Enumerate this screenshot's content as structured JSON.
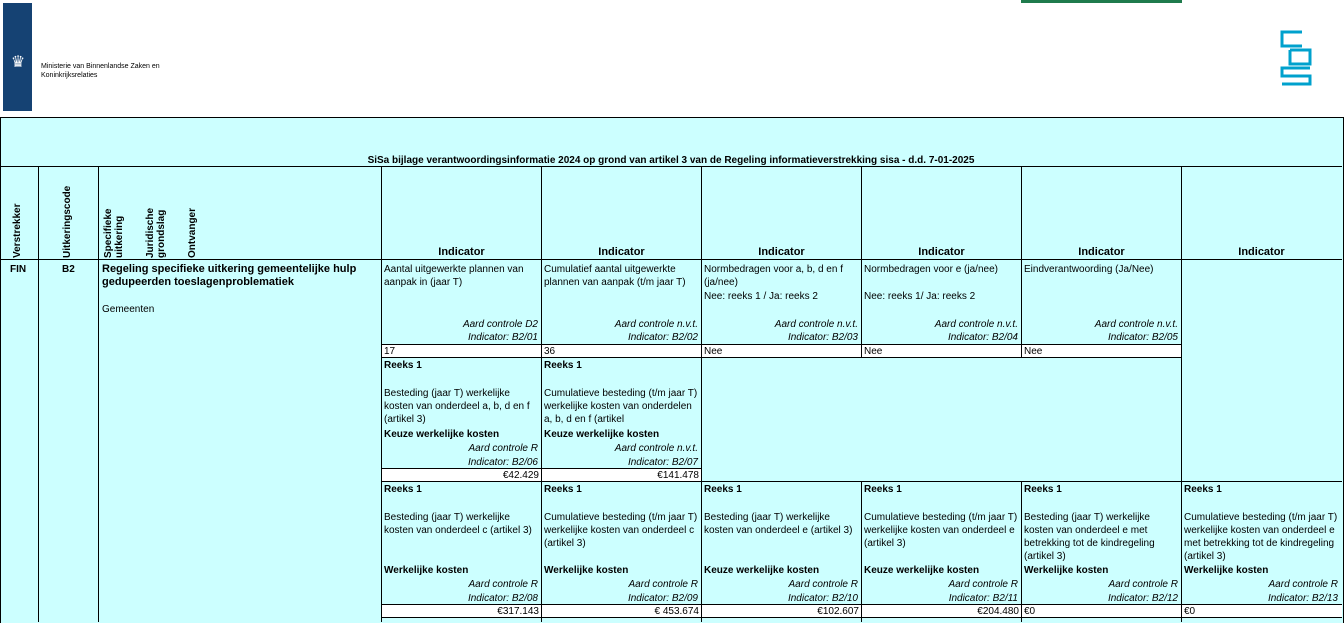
{
  "header": {
    "ministry_line1": "Ministerie van Binnenlandse Zaken en",
    "ministry_line2": "Koninkrijksrelaties"
  },
  "title": "SiSa bijlage verantwoordingsinformatie 2024 op grond van artikel 3 van de Regeling informatieverstrekking sisa - d.d. 7-01-2025",
  "columns": {
    "verstrekker": "Verstrekker",
    "uitkeringscode": "Uitkeringscode",
    "specifieke": "Specifieke uitkering",
    "juridische": "Juridische grondslag",
    "ontvanger": "Ontvanger",
    "indicator": "Indicator"
  },
  "row": {
    "verstrekker": "FIN",
    "code": "B2",
    "regeling": "Regeling specifieke uitkering gemeentelijke hulp gedupeerden toeslagenproblematiek",
    "ontvanger": "Gemeenten"
  },
  "block1": [
    {
      "desc": "Aantal uitgewerkte plannen van aanpak in (jaar T)",
      "aard": "Aard controle D2",
      "ind": "Indicator: B2/01",
      "value": "17"
    },
    {
      "desc": "Cumulatief aantal uitgewerkte plannen van aanpak (t/m jaar T)",
      "aard": "Aard controle n.v.t.",
      "ind": "Indicator: B2/02",
      "value": "36"
    },
    {
      "desc": "Normbedragen voor a, b, d en f (ja/nee)",
      "desc2": "Nee: reeks 1 / Ja: reeks 2",
      "aard": "Aard controle n.v.t.",
      "ind": "Indicator: B2/03",
      "value": "Nee"
    },
    {
      "desc": "Normbedragen voor e (ja/nee)",
      "desc2": "Nee: reeks 1/ Ja: reeks 2",
      "aard": "Aard controle n.v.t.",
      "ind": "Indicator: B2/04",
      "value": "Nee"
    },
    {
      "desc": "Eindverantwoording (Ja/Nee)",
      "aard": "Aard controle n.v.t.",
      "ind": "Indicator: B2/05",
      "value": "Nee"
    }
  ],
  "block2": [
    {
      "reeks": "Reeks 1",
      "desc": "Besteding (jaar T) werkelijke kosten van onderdeel a, b, d en f (artikel 3)",
      "keuze": "Keuze werkelijke kosten",
      "aard": "Aard controle R",
      "ind": "Indicator: B2/06",
      "value": "€42.429"
    },
    {
      "reeks": "Reeks 1",
      "desc": "Cumulatieve besteding (t/m jaar T) werkelijke kosten van onderdelen a, b, d en f (artikel",
      "keuze": "Keuze werkelijke kosten",
      "aard": "Aard controle n.v.t.",
      "ind": "Indicator: B2/07",
      "value": "€141.478"
    }
  ],
  "block3": [
    {
      "reeks": "Reeks 1",
      "desc": "Besteding (jaar T) werkelijke kosten van onderdeel c (artikel 3)",
      "keuze": "Werkelijke kosten",
      "aard": "Aard controle R",
      "ind": "Indicator: B2/08",
      "value": "€317.143"
    },
    {
      "reeks": "Reeks 1",
      "desc": "Cumulatieve besteding (t/m jaar T) werkelijke kosten van onderdeel c (artikel 3)",
      "keuze": "Werkelijke kosten",
      "aard": "Aard controle R",
      "ind": "Indicator: B2/09",
      "value": "€ 453.674"
    },
    {
      "reeks": "Reeks 1",
      "desc": "Besteding (jaar T) werkelijke kosten van onderdeel e (artikel 3)",
      "keuze": "Keuze werkelijke kosten",
      "aard": "Aard controle R",
      "ind": "Indicator: B2/10",
      "value": "€102.607"
    },
    {
      "reeks": "Reeks 1",
      "desc": "Cumulatieve besteding (t/m jaar T) werkelijke kosten van onderdeel e (artikel 3)",
      "keuze": "Keuze werkelijke kosten",
      "aard": "Aard controle R",
      "ind": "Indicator: B2/11",
      "value": "€204.480"
    },
    {
      "reeks": "Reeks 1",
      "desc": "Besteding (jaar T) werkelijke kosten van onderdeel e met betrekking tot de kindregeling (artikel 3)",
      "keuze": "Werkelijke kosten",
      "aard": "Aard controle R",
      "ind": "Indicator: B2/12",
      "value": "€0"
    },
    {
      "reeks": "Reeks 1",
      "desc": "Cumulatieve besteding (t/m jaar T) werkelijke kosten van onderdeel e met betrekking tot de kindregeling (artikel 3)",
      "keuze": "Werkelijke kosten",
      "aard": "Aard controle R",
      "ind": "Indicator: B2/13",
      "value": "€0"
    }
  ]
}
